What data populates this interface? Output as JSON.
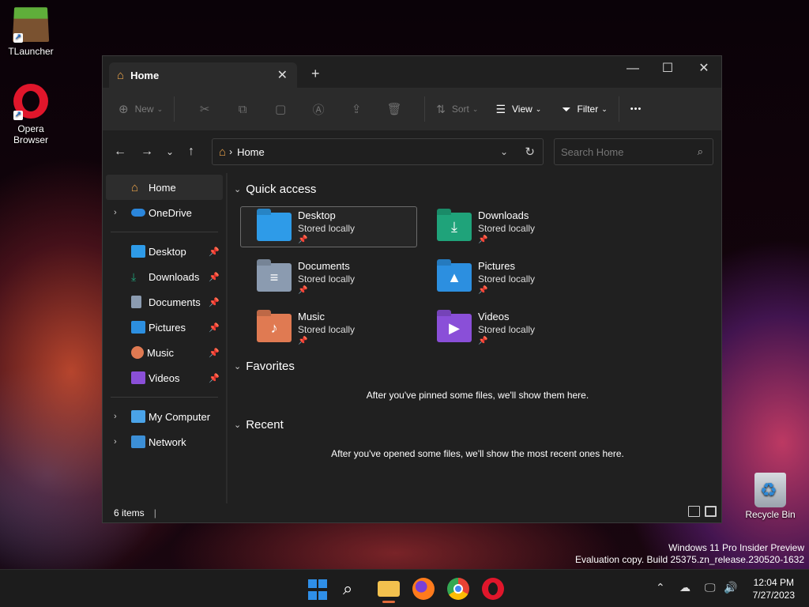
{
  "desktop": {
    "icons": [
      {
        "label": "TLauncher",
        "icon": "minecraft-icon"
      },
      {
        "label": "Opera Browser",
        "icon": "opera-icon"
      },
      {
        "label": "Recycle Bin",
        "icon": "recycle-bin-icon"
      }
    ],
    "watermark_line1": "Windows 11 Pro Insider Preview",
    "watermark_line2": "Evaluation copy. Build 25375.zn_release.230520-1632"
  },
  "window": {
    "tab_title": "Home",
    "new_tab": "+",
    "controls": {
      "minimize": "—",
      "maximize": "☐",
      "close": "✕"
    }
  },
  "toolbar": {
    "new_label": "New",
    "sort_label": "Sort",
    "view_label": "View",
    "filter_label": "Filter",
    "more": "•••"
  },
  "address": {
    "crumb": "Home",
    "search_placeholder": "Search Home"
  },
  "nav": {
    "items": [
      {
        "label": "Home"
      },
      {
        "label": "OneDrive"
      },
      {
        "label": "Desktop"
      },
      {
        "label": "Downloads"
      },
      {
        "label": "Documents"
      },
      {
        "label": "Pictures"
      },
      {
        "label": "Music"
      },
      {
        "label": "Videos"
      },
      {
        "label": "My Computer"
      },
      {
        "label": "Network"
      }
    ]
  },
  "content": {
    "quick_access_title": "Quick access",
    "folders": [
      {
        "name": "Desktop",
        "sub": "Stored locally",
        "color": "#2e9be8"
      },
      {
        "name": "Downloads",
        "sub": "Stored locally",
        "color": "#1fa37a"
      },
      {
        "name": "Documents",
        "sub": "Stored locally",
        "color": "#8b9bb0"
      },
      {
        "name": "Pictures",
        "sub": "Stored locally",
        "color": "#2c8fe0"
      },
      {
        "name": "Music",
        "sub": "Stored locally",
        "color": "#e07a52"
      },
      {
        "name": "Videos",
        "sub": "Stored locally",
        "color": "#8a4fd8"
      }
    ],
    "favorites_title": "Favorites",
    "favorites_empty": "After you've pinned some files, we'll show them here.",
    "recent_title": "Recent",
    "recent_empty": "After you've opened some files, we'll show the most recent ones here."
  },
  "status": {
    "items": "6 items",
    "cursor": "|"
  },
  "taskbar": {
    "time": "12:04 PM",
    "date": "7/27/2023"
  }
}
